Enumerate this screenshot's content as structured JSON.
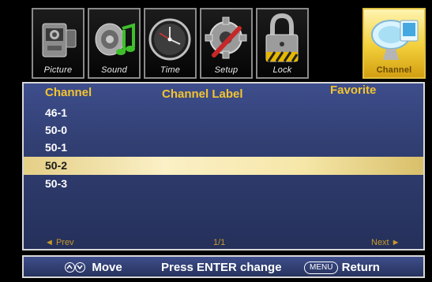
{
  "tabs": [
    {
      "label": "Picture",
      "icon": "camcorder-icon",
      "active": false
    },
    {
      "label": "Sound",
      "icon": "speaker-note-icon",
      "active": false
    },
    {
      "label": "Time",
      "icon": "clock-icon",
      "active": false
    },
    {
      "label": "Setup",
      "icon": "gear-wrench-icon",
      "active": false
    },
    {
      "label": "Lock",
      "icon": "padlock-icon",
      "active": false
    },
    {
      "label": "Channel",
      "icon": "satellite-dish-icon",
      "active": true
    }
  ],
  "columns": {
    "channel": "Channel",
    "label": "Channel Label",
    "favorite": "Favorite"
  },
  "rows": [
    {
      "channel": "46-1",
      "label": "",
      "favorite": ""
    },
    {
      "channel": "50-0",
      "label": "",
      "favorite": ""
    },
    {
      "channel": "50-1",
      "label": "",
      "favorite": ""
    },
    {
      "channel": "50-2",
      "label": "",
      "favorite": "",
      "selected": true
    },
    {
      "channel": "50-3",
      "label": "",
      "favorite": ""
    }
  ],
  "pager": {
    "prev": "◄ Prev",
    "page": "1/1",
    "next": "Next ►"
  },
  "help": {
    "move_label": "Move",
    "enter_label": "Press ENTER change",
    "menu_key": "MENU",
    "return_label": "Return"
  },
  "colors": {
    "accent": "#f3c431",
    "panel": "#313f73",
    "selected_row": "#f6e7a8",
    "active_tab": "#f2cf3a"
  }
}
